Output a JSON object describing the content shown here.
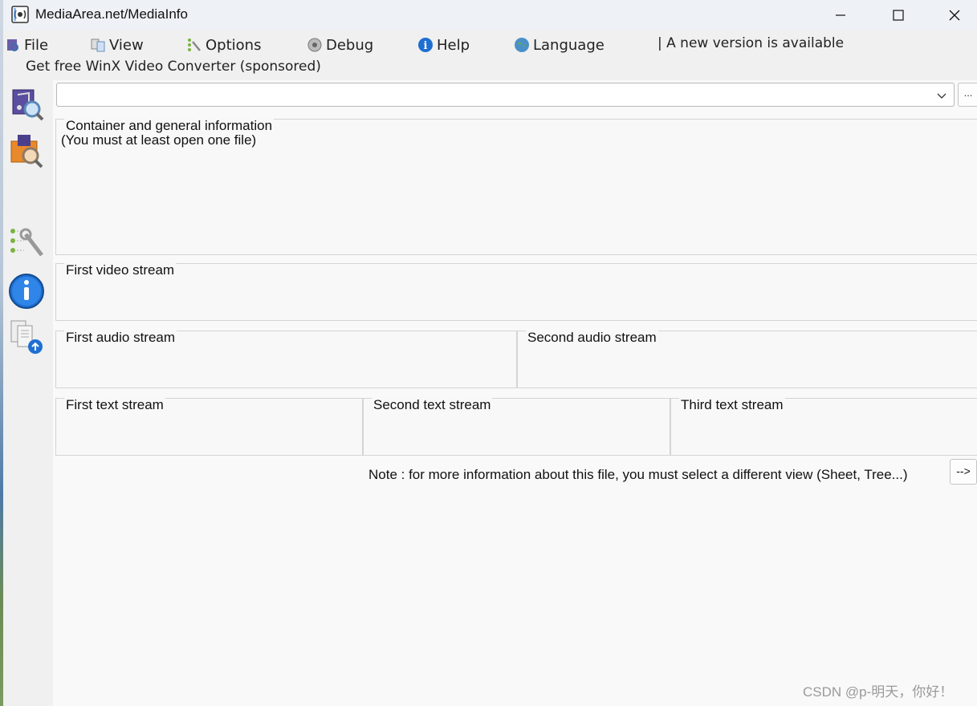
{
  "window": {
    "title": "MediaArea.net/MediaInfo"
  },
  "menu": {
    "items": [
      {
        "label": "File",
        "icon": "file-icon"
      },
      {
        "label": "View",
        "icon": "view-icon"
      },
      {
        "label": "Options",
        "icon": "options-icon"
      },
      {
        "label": "Debug",
        "icon": "debug-icon"
      },
      {
        "label": "Help",
        "icon": "help-icon"
      },
      {
        "label": "Language",
        "icon": "language-icon"
      }
    ],
    "new_version": "| A new version is available",
    "sponsor": "Get free WinX Video Converter (sponsored)"
  },
  "toolbar": {
    "items": [
      {
        "name": "open-file-icon"
      },
      {
        "name": "open-folder-icon"
      },
      {
        "name": "preferences-icon"
      },
      {
        "name": "about-icon"
      },
      {
        "name": "export-icon"
      }
    ]
  },
  "file_selector": {
    "value": "",
    "browse_label": "..."
  },
  "sections": {
    "general": {
      "title": "Container and general information",
      "body": "(You must at least open one file)"
    },
    "video1": {
      "title": "First video stream"
    },
    "audio1": {
      "title": "First audio stream"
    },
    "audio2": {
      "title": "Second audio stream"
    },
    "text1": {
      "title": "First text stream"
    },
    "text2": {
      "title": "Second text stream"
    },
    "text3": {
      "title": "Third text stream"
    }
  },
  "note": "Note : for more information about this file, you must select a different view (Sheet, Tree...)",
  "next_button": "-->",
  "watermark": "CSDN @p-明天，你好！",
  "colors": {
    "accent_blue": "#1f6fd1",
    "panel_bg": "#f8f8f8"
  }
}
